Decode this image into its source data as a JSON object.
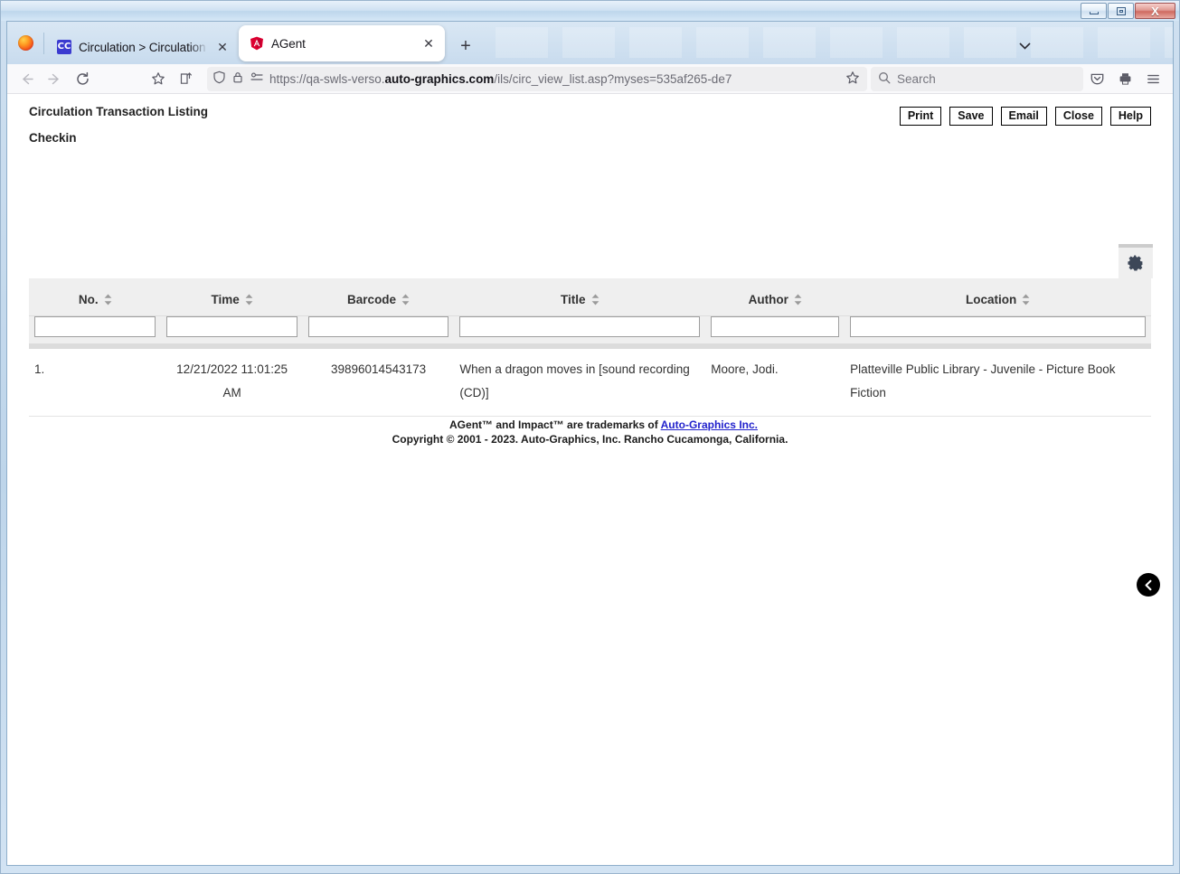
{
  "window": {
    "minimize_label": "Minimize",
    "restore_label": "Restore",
    "close_label": "X"
  },
  "browser": {
    "tabs": [
      {
        "title": "Circulation > Circulation History",
        "favicon": "circulation-favicon",
        "favicon_text": "CC",
        "active": false,
        "close_label": "✕"
      },
      {
        "title": "AGent",
        "favicon": "agent-favicon",
        "favicon_text": "A",
        "active": true,
        "close_label": "✕"
      }
    ],
    "new_tab_label": "+",
    "tab_overflow_label": "⌄",
    "nav": {
      "back_label": "←",
      "forward_label": "→",
      "reload_label": "⟳"
    },
    "url": {
      "prefix": "https://qa-swls-verso.",
      "domain": "auto-graphics.com",
      "suffix": "/ils/circ_view_list.asp?myses=535af265-de7"
    },
    "search": {
      "placeholder": "Search",
      "value": "Search"
    }
  },
  "page": {
    "title": "Circulation Transaction Listing",
    "subtitle": "Checkin",
    "actions": [
      {
        "label": "Print"
      },
      {
        "label": "Save"
      },
      {
        "label": "Email"
      },
      {
        "label": "Close"
      },
      {
        "label": "Help"
      }
    ],
    "settings_icon": "gear-icon",
    "collapse_icon": "chevron-left-icon"
  },
  "table": {
    "columns": [
      {
        "key": "no",
        "label": "No."
      },
      {
        "key": "time",
        "label": "Time"
      },
      {
        "key": "barcode",
        "label": "Barcode"
      },
      {
        "key": "title",
        "label": "Title"
      },
      {
        "key": "author",
        "label": "Author"
      },
      {
        "key": "location",
        "label": "Location"
      }
    ],
    "filters": {
      "no": "",
      "time": "",
      "barcode": "",
      "title": "",
      "author": "",
      "location": ""
    },
    "rows": [
      {
        "no": "1.",
        "time": "12/21/2022 11:01:25 AM",
        "barcode": "39896014543173",
        "title": "When a dragon moves in [sound recording (CD)]",
        "author": "Moore, Jodi.",
        "location": "Platteville Public Library - Juvenile - Picture Book Fiction"
      }
    ]
  },
  "footer": {
    "line1_prefix": "AGent™ and Impact™ are trademarks of ",
    "line1_link": "Auto-Graphics Inc.",
    "line2": "Copyright © 2001 - 2023. Auto-Graphics, Inc. Rancho Cucamonga, California."
  }
}
